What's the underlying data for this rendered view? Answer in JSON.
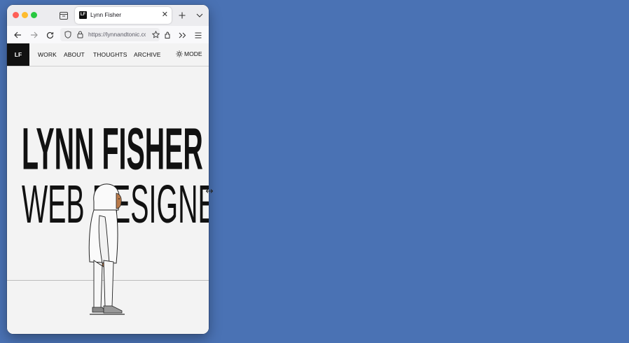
{
  "browser": {
    "tab": {
      "title": "Lynn Fisher",
      "favicon_text": "LF"
    },
    "url": "https://lynnandtonic.com",
    "icons": [
      "sidebar-icon",
      "new-tab-icon",
      "tab-list-icon",
      "back-icon",
      "forward-icon",
      "reload-icon",
      "shield-icon",
      "lock-icon",
      "bookmark-star-icon",
      "extensions-icon",
      "overflow-icon",
      "menu-icon"
    ]
  },
  "site": {
    "logo": "LF",
    "nav": [
      "WORK",
      "ABOUT",
      "THOUGHTS",
      "ARCHIVE"
    ],
    "mode_label": "MODE",
    "headline_line1": "LYNN FISHER",
    "headline_line2": "WEB DESIGNER"
  },
  "colors": {
    "desktop": "#4a72b4",
    "page_background": "#f3f3f3",
    "text": "#111111"
  }
}
